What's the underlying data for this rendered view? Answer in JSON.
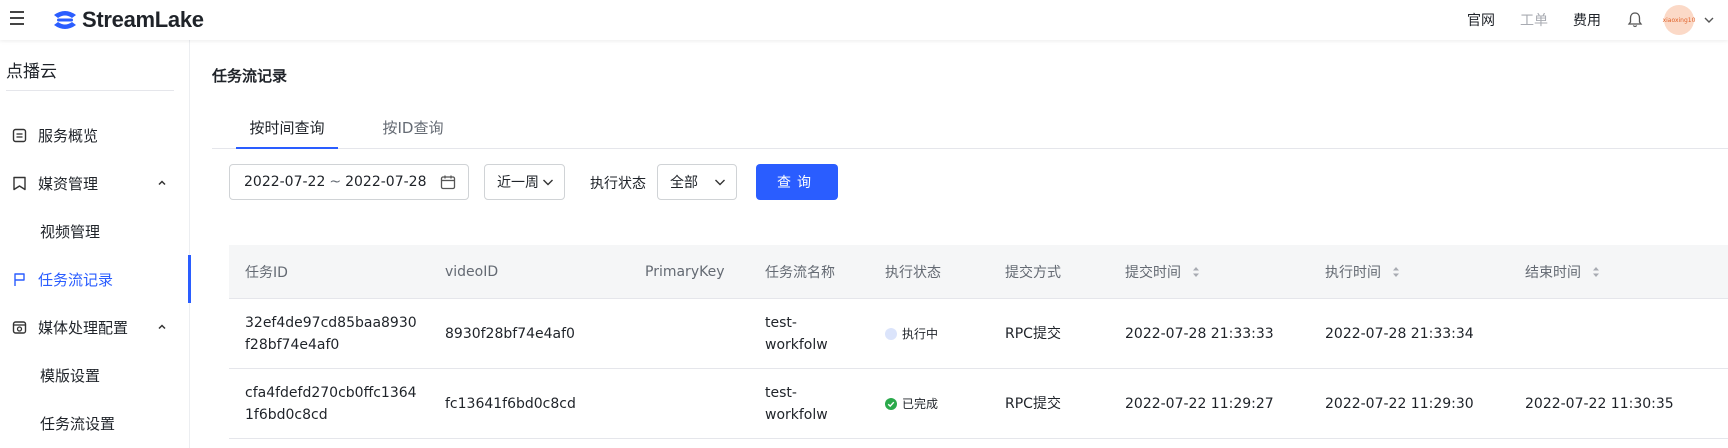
{
  "topbar": {
    "brand": "StreamLake",
    "links": [
      "官网",
      "工单",
      "费用"
    ],
    "avatar_text": "xiaoxing10",
    "colors": {
      "brand_blue": "#2a5dff"
    }
  },
  "sidebar": {
    "title": "点播云",
    "items": [
      {
        "label": "服务概览",
        "icon": "doc-icon"
      },
      {
        "label": "媒资管理",
        "icon": "bookmark-icon",
        "expanded": true
      },
      {
        "label": "视频管理",
        "sub": true
      },
      {
        "label": "任务流记录",
        "icon": "flag-icon",
        "active": true
      },
      {
        "label": "媒体处理配置",
        "icon": "media-icon",
        "expanded": true
      },
      {
        "label": "模版设置",
        "sub": true
      },
      {
        "label": "任务流设置",
        "sub": true
      }
    ]
  },
  "main": {
    "page_title": "任务流记录",
    "tabs": [
      {
        "label": "按时间查询",
        "active": true
      },
      {
        "label": "按ID查询",
        "active": false
      }
    ],
    "filters": {
      "date_start": "2022-07-22",
      "date_sep": "~",
      "date_end": "2022-07-28",
      "range_select": "近一周",
      "status_label": "执行状态",
      "status_select": "全部",
      "query_button": "查询"
    },
    "table": {
      "columns": [
        "任务ID",
        "videoID",
        "PrimaryKey",
        "任务流名称",
        "执行状态",
        "提交方式",
        "提交时间",
        "执行时间",
        "结束时间"
      ],
      "rows": [
        {
          "task_id_1": "32ef4de97cd85baa8930",
          "task_id_2": "f28bf74e4af0",
          "video_id": "8930f28bf74e4af0",
          "primary_key": "",
          "flow_name_1": "test-",
          "flow_name_2": "workfolw",
          "status": "执行中",
          "submit_method": "RPC提交",
          "submit_time": "2022-07-28 21:33:33",
          "exec_time": "2022-07-28 21:33:34",
          "end_time": ""
        },
        {
          "task_id_1": "cfa4fdefd270cb0ffc1364",
          "task_id_2": "1f6bd0c8cd",
          "video_id": "fc13641f6bd0c8cd",
          "primary_key": "",
          "flow_name_1": "test-",
          "flow_name_2": "workfolw",
          "status": "已完成",
          "submit_method": "RPC提交",
          "submit_time": "2022-07-22 11:29:27",
          "exec_time": "2022-07-22 11:29:30",
          "end_time": "2022-07-22 11:30:35"
        }
      ]
    }
  }
}
